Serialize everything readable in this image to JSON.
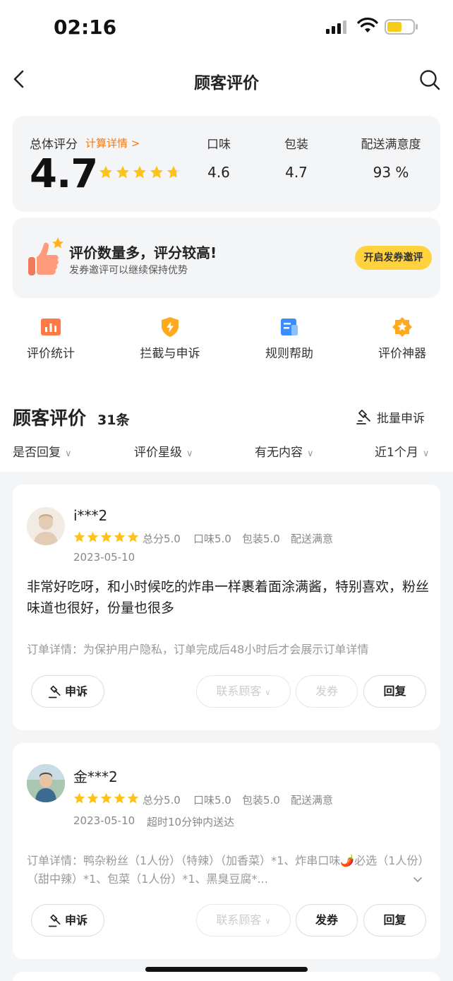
{
  "status_bar": {
    "time": "02:16"
  },
  "nav": {
    "title": "顾客评价"
  },
  "score": {
    "overall_label": "总体评分",
    "detail_link": "计算详情 >",
    "overall_value": "4.7",
    "overall_stars": 4.7,
    "columns": [
      {
        "label": "口味",
        "value": "4.6"
      },
      {
        "label": "包装",
        "value": "4.7"
      },
      {
        "label": "配送满意度",
        "value": "93 %"
      }
    ]
  },
  "promo": {
    "title": "评价数量多，评分较高!",
    "subtitle": "发券邀评可以继续保持优势",
    "button": "开启发券邀评"
  },
  "tools": [
    {
      "label": "评价统计",
      "icon": "bar-chart-icon"
    },
    {
      "label": "拦截与申诉",
      "icon": "shield-bolt-icon"
    },
    {
      "label": "规则帮助",
      "icon": "document-icon"
    },
    {
      "label": "评价神器",
      "icon": "star-badge-icon"
    }
  ],
  "section": {
    "title": "顾客评价",
    "count": "31条",
    "batch_label": "批量申诉"
  },
  "filters": [
    {
      "label": "是否回复"
    },
    {
      "label": "评价星级"
    },
    {
      "label": "有无内容"
    },
    {
      "label": "近1个月"
    }
  ],
  "reviews": [
    {
      "user": "i***2",
      "stars": 5,
      "total": "总分5.0",
      "taste": "口味5.0",
      "package": "包装5.0",
      "delivery": "配送满意",
      "date": "2023-05-10",
      "extra": "",
      "comment": "非常好吃呀，和小时候吃的炸串一样裹着面涂满酱，特别喜欢，粉丝味道也很好，份量也很多",
      "order": "订单详情：为保护用户隐私，订单完成后48小时后才会展示订单详情",
      "buttons": {
        "appeal": "申诉",
        "contact": "联系顾客",
        "coupon": "发券",
        "reply": "回复"
      }
    },
    {
      "user": "金***2",
      "stars": 5,
      "total": "总分5.0",
      "taste": "口味5.0",
      "package": "包装5.0",
      "delivery": "配送满意",
      "date": "2023-05-10",
      "extra": "超时10分钟内送达",
      "comment": "",
      "order": "订单详情：鸭杂粉丝（1人份）（特辣）（加香菜）*1、炸串口味🌶️必选（1人份）（甜中辣）*1、包菜（1人份）*1、黑臭豆腐*...",
      "buttons": {
        "appeal": "申诉",
        "contact": "联系顾客",
        "coupon": "发券",
        "reply": "回复"
      }
    }
  ]
}
